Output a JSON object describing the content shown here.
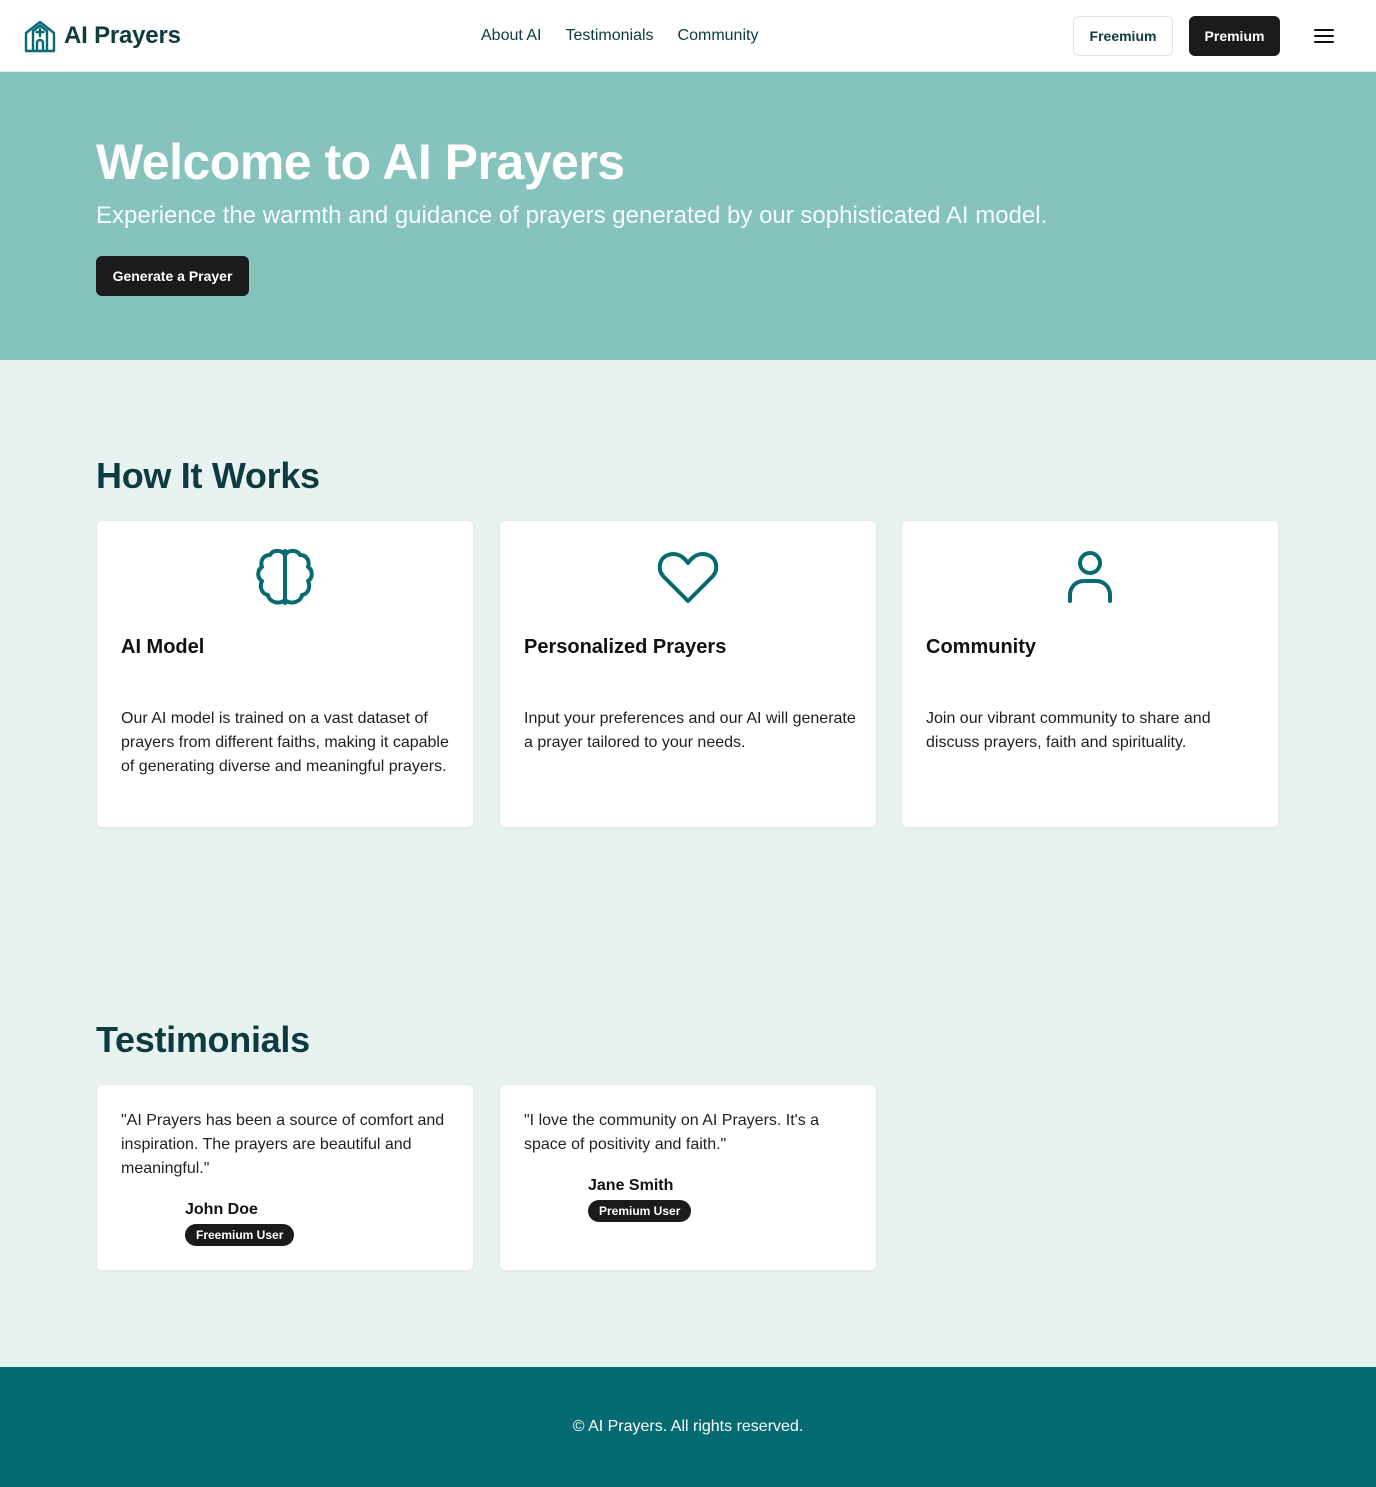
{
  "header": {
    "brand": "AI Prayers",
    "logo_icon": "church-icon",
    "nav": [
      "About AI",
      "Testimonials",
      "Community"
    ],
    "freemium_label": "Freemium",
    "premium_label": "Premium",
    "menu_icon": "menu-icon"
  },
  "hero": {
    "title": "Welcome to AI Prayers",
    "subtitle": "Experience the warmth and guidance of prayers generated by our sophisticated AI model.",
    "cta_label": "Generate a Prayer"
  },
  "how_it_works": {
    "title": "How It Works",
    "cards": [
      {
        "icon": "brain-icon",
        "title": "AI Model",
        "text": "Our AI model is trained on a vast dataset of prayers from different faiths, making it capable of generating diverse and meaningful prayers."
      },
      {
        "icon": "heart-icon",
        "title": "Personalized Prayers",
        "text": "Input your preferences and our AI will generate a prayer tailored to your needs."
      },
      {
        "icon": "user-icon",
        "title": "Community",
        "text": "Join our vibrant community to share and discuss prayers, faith and spirituality."
      }
    ]
  },
  "testimonials": {
    "title": "Testimonials",
    "items": [
      {
        "quote": "\"AI Prayers has been a source of comfort and inspiration. The prayers are beautiful and meaningful.\"",
        "name": "John Doe",
        "badge": "Freemium User"
      },
      {
        "quote": "\"I love the community on AI Prayers. It's a space of positivity and faith.\"",
        "name": "Jane Smith",
        "badge": "Premium User"
      }
    ]
  },
  "footer": {
    "copyright": "© AI Prayers. All rights reserved."
  },
  "colors": {
    "brand_teal": "#056a72",
    "hero_bg": "#86c3bc",
    "page_bg": "#e8f3f1",
    "dark": "#1b1b1d",
    "heading": "#0d3b3f"
  }
}
